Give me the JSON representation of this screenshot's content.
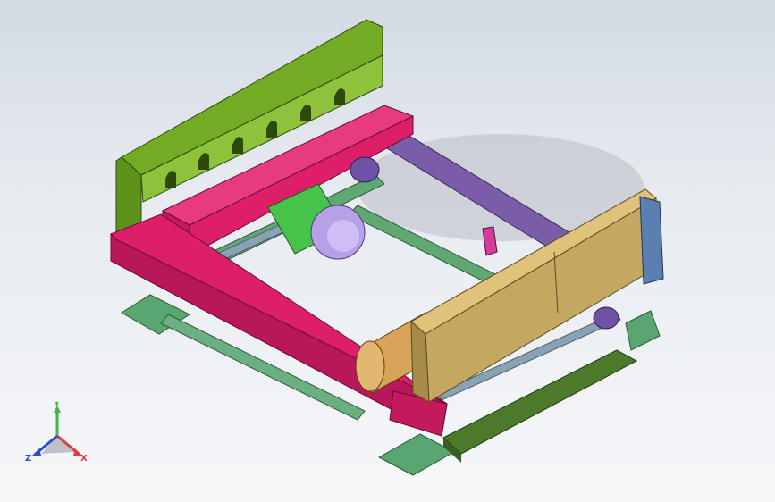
{
  "viewport": {
    "background_top": "#d2dae3",
    "background_bottom": "#f6f7f9"
  },
  "model": {
    "parts": [
      {
        "name": "left-panel",
        "color": "#74ab24"
      },
      {
        "name": "magenta-frame",
        "color": "#dc1f68"
      },
      {
        "name": "tan-panel",
        "color": "#c4a862"
      },
      {
        "name": "purple-beam",
        "color": "#7a5ca8"
      },
      {
        "name": "green-motor",
        "color": "#47c24a"
      },
      {
        "name": "lavender-motor-cap",
        "color": "#b6a0e6"
      },
      {
        "name": "tan-motor",
        "color": "#d7a45a"
      },
      {
        "name": "teal-base-plates",
        "color": "#57a56e"
      },
      {
        "name": "shafts",
        "color": "#8aa2b5"
      },
      {
        "name": "dark-green-bar",
        "color": "#4d7a2a"
      }
    ]
  },
  "triad": {
    "x_label": "X",
    "y_label": "Y",
    "z_label": "Z",
    "x_color": "#e43b3b",
    "y_color": "#3fb34f",
    "z_color": "#2f4bd1"
  }
}
